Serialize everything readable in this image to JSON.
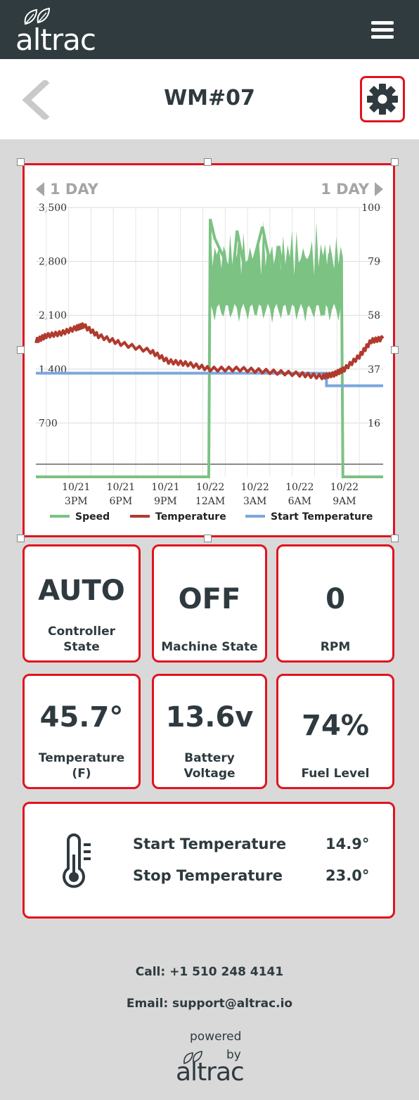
{
  "header": {
    "logo_text": "altrac",
    "menu_icon": "hamburger-menu-icon"
  },
  "titlebar": {
    "title": "WM#07",
    "back_icon": "chevron-left-icon",
    "settings_icon": "gear-icon"
  },
  "chart": {
    "nav_prev": "1 DAY",
    "nav_next": "1 DAY"
  },
  "chart_data": {
    "type": "line",
    "left_ticks": [
      "3,500",
      "2,800",
      "2,100",
      "1,400",
      "700"
    ],
    "left_tick_values": [
      3500,
      2800,
      2100,
      1400,
      700
    ],
    "right_ticks": [
      "100",
      "79",
      "58",
      "37",
      "16"
    ],
    "right_tick_values": [
      100,
      79,
      58,
      37,
      16
    ],
    "left_ylim": [
      0,
      3500
    ],
    "right_ylim": [
      -5,
      100
    ],
    "x_ticks": [
      {
        "line1": "10/21",
        "line2": "3PM",
        "h": 15
      },
      {
        "line1": "10/21",
        "line2": "6PM",
        "h": 18
      },
      {
        "line1": "10/21",
        "line2": "9PM",
        "h": 21
      },
      {
        "line1": "10/22",
        "line2": "12AM",
        "h": 24
      },
      {
        "line1": "10/22",
        "line2": "3AM",
        "h": 27
      },
      {
        "line1": "10/22",
        "line2": "6AM",
        "h": 30
      },
      {
        "line1": "10/22",
        "line2": "9AM",
        "h": 33
      }
    ],
    "xlim_hours": [
      12.3,
      35.6
    ],
    "grid": true,
    "legend_position": "bottom",
    "series": [
      {
        "name": "Speed",
        "color": "#7cc283",
        "axis": "left",
        "points": [
          [
            12.3,
            0
          ],
          [
            23.9,
            0
          ],
          [
            24.0,
            3350
          ],
          [
            24.3,
            3100
          ],
          [
            25.5,
            2600
          ],
          [
            25.8,
            3200
          ],
          [
            26.5,
            2500
          ],
          [
            27.5,
            3250
          ],
          [
            28.2,
            2600
          ],
          [
            28.6,
            3000
          ],
          [
            29.2,
            2300
          ],
          [
            30.0,
            2500
          ],
          [
            30.8,
            2200
          ],
          [
            31.2,
            2500
          ],
          [
            31.6,
            2100
          ],
          [
            32.0,
            2900
          ],
          [
            32.5,
            2400
          ],
          [
            32.8,
            2850
          ],
          [
            32.9,
            0
          ],
          [
            35.6,
            0
          ]
        ],
        "fill_range": [
          [
            24.0,
            32.9,
            2000,
            3350
          ]
        ]
      },
      {
        "name": "Temperature",
        "color": "#b03a2e",
        "axis": "right",
        "points": [
          [
            12.3,
            48
          ],
          [
            13.0,
            50
          ],
          [
            14.0,
            51
          ],
          [
            15.0,
            53
          ],
          [
            15.5,
            54
          ],
          [
            16.5,
            50
          ],
          [
            18.0,
            47
          ],
          [
            20.0,
            44
          ],
          [
            21.2,
            40
          ],
          [
            22.5,
            39
          ],
          [
            24.0,
            37
          ],
          [
            26.0,
            37
          ],
          [
            28.0,
            36
          ],
          [
            30.0,
            35
          ],
          [
            31.5,
            34
          ],
          [
            32.3,
            35
          ],
          [
            33.0,
            37
          ],
          [
            34.0,
            42
          ],
          [
            34.8,
            48
          ],
          [
            35.6,
            49
          ]
        ]
      },
      {
        "name": "Start Temperature",
        "color": "#7aa7dc",
        "axis": "right",
        "points": [
          [
            12.3,
            35.4
          ],
          [
            31.8,
            35.4
          ],
          [
            31.8,
            30.5
          ],
          [
            35.6,
            30.5
          ]
        ]
      }
    ]
  },
  "stats": [
    {
      "value": "AUTO",
      "label_lines": [
        "Controller",
        "State"
      ]
    },
    {
      "value": "OFF",
      "label_lines": [
        "",
        "Machine State"
      ]
    },
    {
      "value": "0",
      "label_lines": [
        "",
        "RPM"
      ]
    },
    {
      "value": "45.7°",
      "label_lines": [
        "Temperature",
        "(F)"
      ]
    },
    {
      "value": "13.6v",
      "label_lines": [
        "Battery",
        "Voltage"
      ]
    },
    {
      "value": "74%",
      "label_lines": [
        "",
        "Fuel Level"
      ]
    }
  ],
  "temperature_settings": {
    "icon": "thermometer-icon",
    "start_label": "Start Temperature",
    "start_value": "14.9°",
    "stop_label": "Stop Temperature",
    "stop_value": "23.0°"
  },
  "footer": {
    "call": "Call: +1 510 248 4141",
    "email": "Email: support@altrac.io",
    "powered": "powered",
    "by": "by",
    "brand": "altrac"
  }
}
